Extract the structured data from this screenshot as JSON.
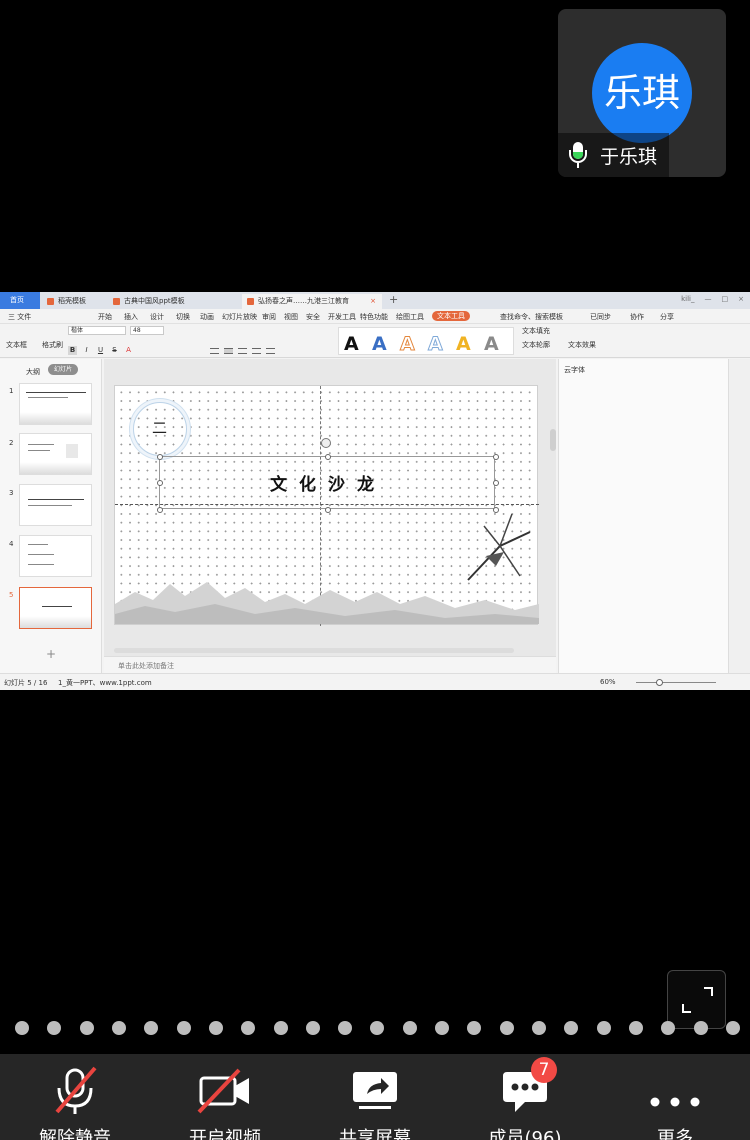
{
  "participant": {
    "avatar_text": "乐琪",
    "name": "于乐琪",
    "avatar_color": "#1a7df2"
  },
  "shared_screen": {
    "tabs": [
      "首页",
      "稻壳模板",
      "古典中国风ppt模板",
      "弘扬春之声……九港三江教育"
    ],
    "account": "kili_",
    "menus": [
      "三 文件",
      "开始",
      "插入",
      "设计",
      "切换",
      "动画",
      "幻灯片放映",
      "审阅",
      "视图",
      "安全",
      "开发工具",
      "特色功能",
      "绘图工具",
      "文本工具"
    ],
    "menu_active": "文本工具",
    "menu_right": [
      "查找命令、搜索模板",
      "已同步",
      "协作",
      "分享"
    ],
    "ribbon": {
      "textbox_label": "文本框",
      "format_painter": "格式刷",
      "font_name": "楷体",
      "font_size": "48",
      "fill_label": "文本填充",
      "outline_label": "文本轮廓",
      "effect_label": "文本效果"
    },
    "panel_tabs": [
      "大纲",
      "幻灯片"
    ],
    "thumbs": [
      {
        "num": "1",
        "title": "弘扬春之声 ……"
      },
      {
        "num": "2",
        "title": "目录"
      },
      {
        "num": "3",
        "title": "弘扬传统文化"
      },
      {
        "num": "4",
        "title": "传统节日"
      },
      {
        "num": "5",
        "title": "文化沙龙"
      }
    ],
    "slide": {
      "number_mark": "二",
      "title": "文化沙龙"
    },
    "notes_placeholder": "单击此处添加备注",
    "right_panel_title": "云字体",
    "status_left": "幻灯片 5 / 16",
    "status_theme": "1_黄一PPT、www.1ppt.com",
    "zoom": "60%"
  },
  "toolbar": {
    "unmute_label": "解除静音",
    "video_label": "开启视频",
    "share_label": "共享屏幕",
    "members_label": "成员(96)",
    "members_badge": "7",
    "more_label": "更多"
  }
}
